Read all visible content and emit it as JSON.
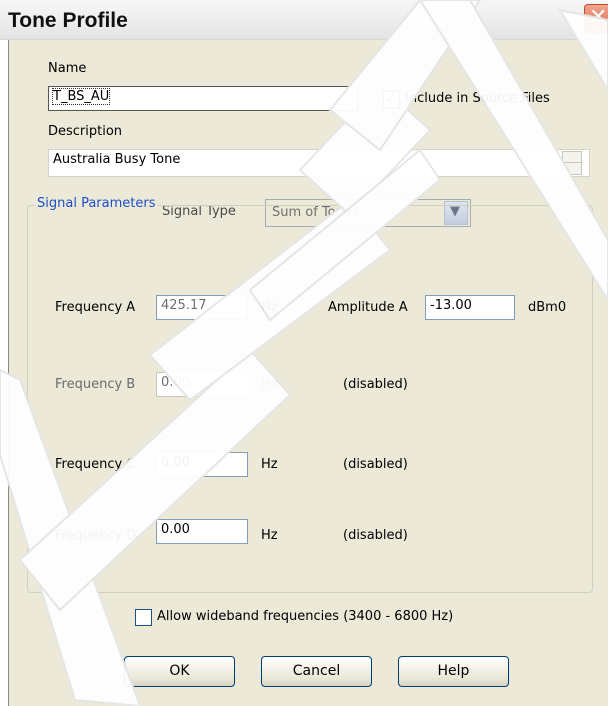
{
  "window": {
    "title": "Tone Profile"
  },
  "name": {
    "label": "Name",
    "value": "T_BS_AU"
  },
  "include_source": {
    "label": "Include in Source Files",
    "checked": true
  },
  "description": {
    "label": "Description",
    "value": "Australia Busy Tone"
  },
  "signal_type": {
    "label": "Signal Type",
    "value": "Sum of Tones"
  },
  "signal_parameters": {
    "title": "Signal Parameters",
    "hz_unit": "Hz",
    "freq_a": {
      "label": "Frequency A",
      "value": "425.17"
    },
    "amp_a": {
      "label": "Amplitude A",
      "value": "-13.00",
      "unit": "dBm0"
    },
    "freq_b": {
      "label": "Frequency B",
      "value": "0.00",
      "status": "(disabled)"
    },
    "freq_c": {
      "label": "Frequency C",
      "value": "0.00",
      "status": "(disabled)"
    },
    "freq_d": {
      "label": "Frequency D",
      "value": "0.00",
      "status": "(disabled)"
    }
  },
  "wideband": {
    "label": "Allow wideband frequencies (3400 - 6800 Hz)",
    "checked": false
  },
  "buttons": {
    "ok": "OK",
    "cancel": "Cancel",
    "help": "Help"
  },
  "icons": {
    "close": "close-icon",
    "checkmark": "checkmark-icon",
    "dropdown": "chevron-down-icon"
  }
}
